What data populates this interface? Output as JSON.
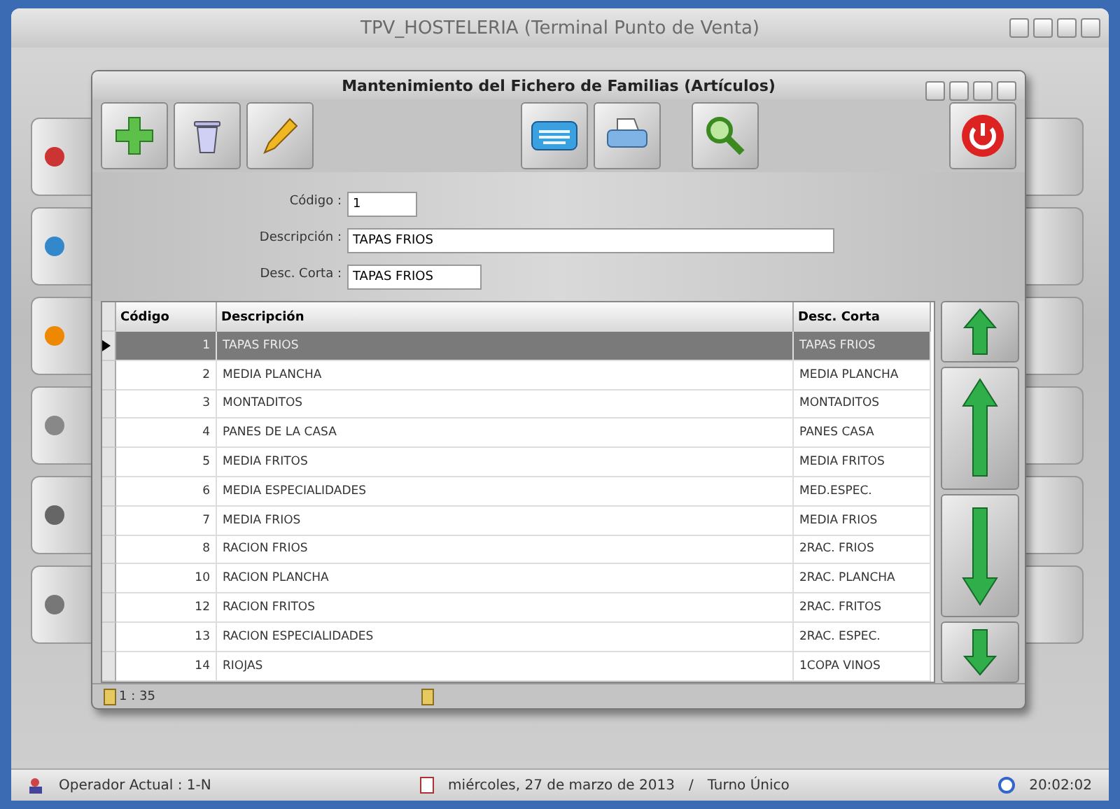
{
  "window": {
    "title": "TPV_HOSTELERIA (Terminal Punto de Venta)"
  },
  "dialog": {
    "title": "Mantenimiento del Fichero de Familias (Artículos)",
    "toolbar": [
      {
        "kind": "add"
      },
      {
        "kind": "delete"
      },
      {
        "kind": "edit"
      },
      {
        "kind": "gap"
      },
      {
        "kind": "keyboard"
      },
      {
        "kind": "print"
      },
      {
        "kind": "gap"
      },
      {
        "kind": "search"
      },
      {
        "kind": "spacer"
      },
      {
        "kind": "exit"
      }
    ],
    "form": [
      {
        "label": "Código :",
        "value": "1"
      },
      {
        "label": "Descripción :",
        "value": "TAPAS FRIOS"
      },
      {
        "label": "Desc. Corta :",
        "value": "TAPAS FRIOS"
      }
    ],
    "table": {
      "columns": [
        "Código",
        "Descripción",
        "Desc. Corta"
      ],
      "rows": [
        {
          "cells": [
            "1",
            "TAPAS FRIOS",
            "TAPAS FRIOS"
          ],
          "selected": true
        },
        {
          "cells": [
            "2",
            "MEDIA PLANCHA",
            "MEDIA PLANCHA"
          ],
          "selected": false
        },
        {
          "cells": [
            "3",
            "MONTADITOS",
            "MONTADITOS"
          ],
          "selected": false
        },
        {
          "cells": [
            "4",
            "PANES DE LA CASA",
            "PANES CASA"
          ],
          "selected": false
        },
        {
          "cells": [
            "5",
            "MEDIA FRITOS",
            "MEDIA FRITOS"
          ],
          "selected": false
        },
        {
          "cells": [
            "6",
            "MEDIA ESPECIALIDADES",
            "MED.ESPEC."
          ],
          "selected": false
        },
        {
          "cells": [
            "7",
            "MEDIA FRIOS",
            "MEDIA FRIOS"
          ],
          "selected": false
        },
        {
          "cells": [
            "8",
            "RACION FRIOS",
            "2RAC. FRIOS"
          ],
          "selected": false
        },
        {
          "cells": [
            "10",
            "RACION PLANCHA",
            "2RAC. PLANCHA"
          ],
          "selected": false
        },
        {
          "cells": [
            "12",
            "RACION FRITOS",
            "2RAC. FRITOS"
          ],
          "selected": false
        },
        {
          "cells": [
            "13",
            "RACION ESPECIALIDADES",
            "2RAC. ESPEC."
          ],
          "selected": false
        },
        {
          "cells": [
            "14",
            "RIOJAS",
            "1COPA VINOS"
          ],
          "selected": false
        }
      ]
    },
    "nav": [
      {
        "kind": "first"
      },
      {
        "kind": "prev-page"
      },
      {
        "kind": "next-page"
      },
      {
        "kind": "last"
      }
    ],
    "status": "1 : 35"
  },
  "status_bar": {
    "operator": "Operador Actual : 1-N",
    "date": "miércoles, 27 de marzo de 2013",
    "separator": "/",
    "shift": "Turno Único",
    "time": "20:02:02"
  }
}
